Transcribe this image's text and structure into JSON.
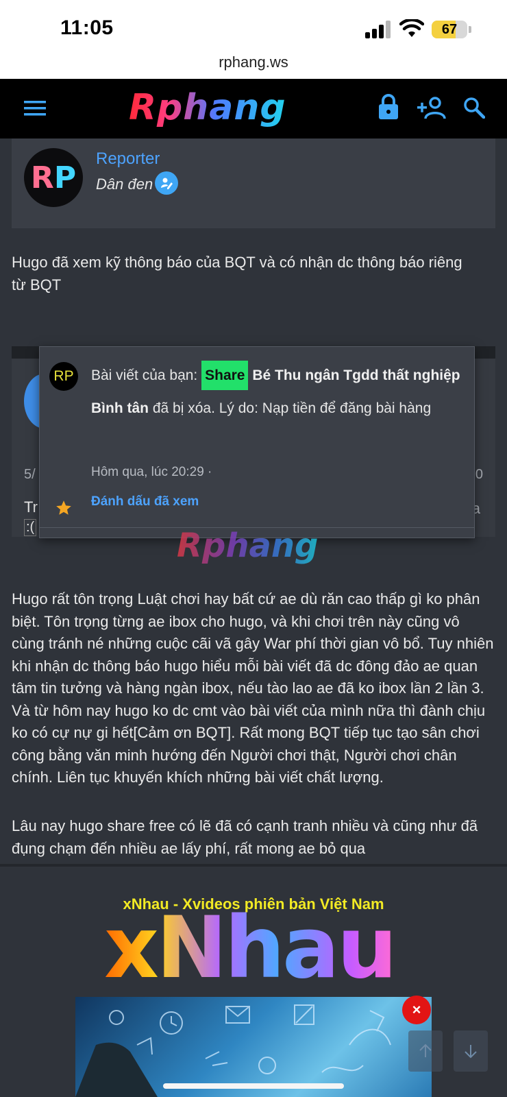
{
  "status": {
    "time": "11:05",
    "battery": "67",
    "battery_level": 0.67
  },
  "browser": {
    "url": "rphang.ws"
  },
  "nav": {
    "logo": "Rphang"
  },
  "author": {
    "initials_r": "R",
    "initials_p": "P",
    "name": "Reporter",
    "title": "Dân đen"
  },
  "post": {
    "paragraph1": "Hugo đã xem kỹ thông báo của BQT và có nhận dc thông báo riêng từ BQT",
    "paragraph2": "Hugo rất tôn trọng Luật chơi hay bất cứ ae dù răn cao thấp gì ko phân biệt. Tôn trọng từng ae ibox cho hugo, và khi chơi trên này cũng vô cùng tránh né những cuộc cãi vã gây War phí thời gian vô bổ. Tuy nhiên khi nhận dc thông báo hugo hiểu mỗi bài viết đã dc đông đảo ae quan tâm tin tưởng và hàng ngàn ibox, nếu tào lao ae đã ko ibox lần 2 lần 3. Và từ hôm nay hugo ko dc cmt vào bài viết của mình nữa thì đành chịu ko có cự nự gi hết[Cảm ơn BQT]. Rất mong BQT tiếp tục tạo sân chơi công bằng văn minh hướng đến Người chơi thật, Người chơi chân chính. Liên tục khuyến khích những bài viết chất lượng.",
    "paragraph3": "Lâu nay hugo share free có lẽ đã có cạnh tranh nhiều và cũng như đã đụng chạm đến nhiều ae lấy phí, rất mong ae bỏ qua"
  },
  "embed": {
    "date_partial": "5/",
    "text_partial": "Tr",
    "text_partial2": ":(",
    "right_partial": "0",
    "right_partial2": "a"
  },
  "notification": {
    "avatar": "RP",
    "prefix": "Bài viết của bạn: ",
    "tag": "Share",
    "title": " Bé Thu ngân Tgdd thất nghiệp Bình tân",
    "suffix": " đã bị xóa. Lý do: Nạp tiền để đăng bài hàng",
    "time": "Hôm qua, lúc 20:29 ·",
    "mark_read": "Đánh dấu đã xem"
  },
  "watermark": "Rphang",
  "promo": {
    "title": "xNhau - Xvideos phiên bản Việt Nam",
    "logo": "xNhau"
  },
  "ad": {
    "close": "×"
  }
}
